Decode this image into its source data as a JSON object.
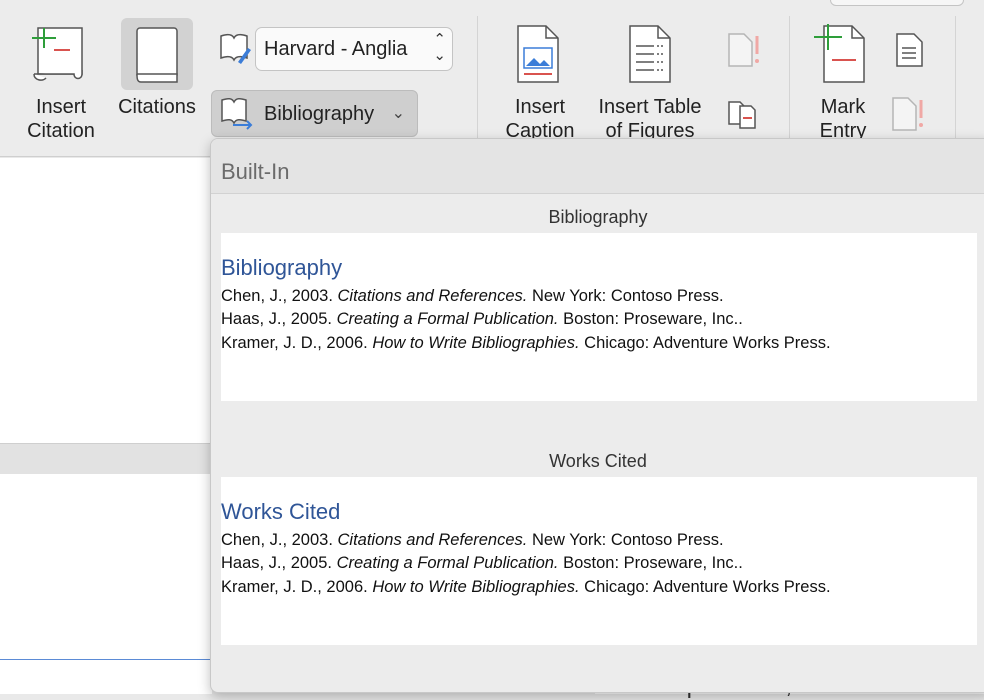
{
  "ribbon": {
    "insert_citation": "Insert\nCitation",
    "insert_citation_line1": "Insert",
    "insert_citation_line2": "Citation",
    "citations": "Citations",
    "style_value": "Harvard - Anglia",
    "bibliography_button": "Bibliography",
    "insert_caption_line1": "Insert",
    "insert_caption_line2": "Caption",
    "insert_tof_line1": "Insert Table",
    "insert_tof_line2": "of Figures",
    "mark_entry_line1": "Mark",
    "mark_entry_line2": "Entry",
    "accent_green": "#2e9e3a",
    "accent_red": "#d9534f"
  },
  "dropdown": {
    "header": "Built-In",
    "items": [
      {
        "section_title": "Bibliography",
        "heading": "Bibliography",
        "entries": [
          {
            "pre": "Chen, J., 2003. ",
            "title": "Citations and References.",
            "post": " New York: Contoso Press."
          },
          {
            "pre": "Haas, J., 2005. ",
            "title": "Creating a Formal Publication.",
            "post": " Boston: Proseware, Inc.."
          },
          {
            "pre": "Kramer, J. D., 2006. ",
            "title": "How to Write Bibliographies.",
            "post": " Chicago: Adventure Works Press."
          }
        ]
      },
      {
        "section_title": "Works Cited",
        "heading": "Works Cited",
        "entries": [
          {
            "pre": "Chen, J., 2003. ",
            "title": "Citations and References.",
            "post": " New York: Contoso Press."
          },
          {
            "pre": "Haas, J., 2005. ",
            "title": "Creating a Formal Publication.",
            "post": " Boston: Proseware, Inc.."
          },
          {
            "pre": "Kramer, J. D., 2006. ",
            "title": "How to Write Bibliographies.",
            "post": " Chicago: Adventure Works Press."
          }
        ]
      }
    ]
  },
  "document": {
    "bottom_text": "Copenhaver, John. The Eas"
  }
}
